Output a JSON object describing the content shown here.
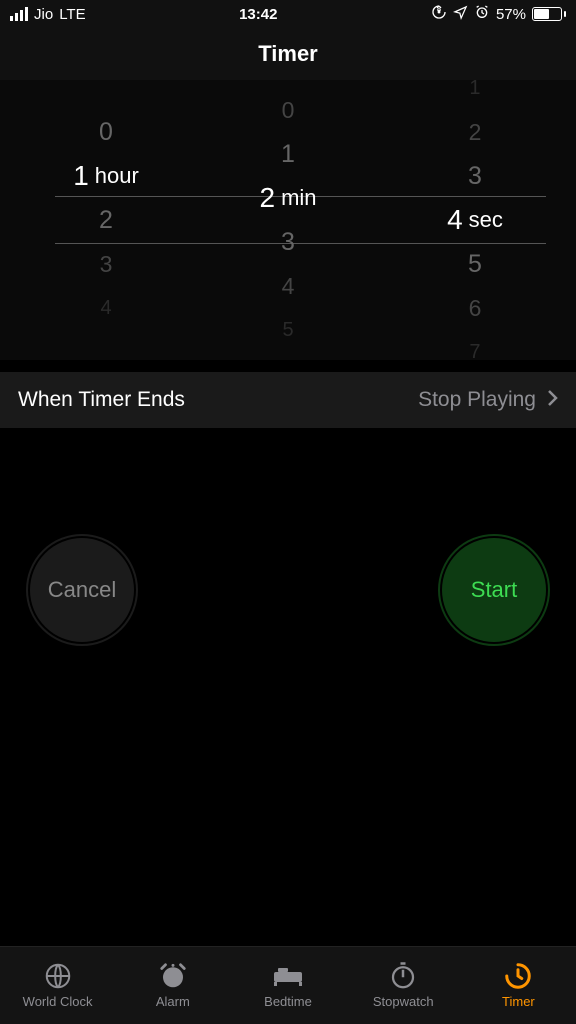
{
  "status": {
    "carrier": "Jio",
    "network": "LTE",
    "time": "13:42",
    "battery_pct": "57%"
  },
  "header": {
    "title": "Timer"
  },
  "picker": {
    "hours": {
      "selected": "1",
      "unit": "hour",
      "above": [
        "0"
      ],
      "below": [
        "2",
        "3",
        "4"
      ]
    },
    "mins": {
      "selected": "2",
      "unit": "min",
      "above": [
        "0",
        "1"
      ],
      "below": [
        "3",
        "4",
        "5"
      ]
    },
    "secs": {
      "selected": "4",
      "unit": "sec",
      "above": [
        "1",
        "2",
        "3"
      ],
      "below": [
        "5",
        "6",
        "7"
      ]
    }
  },
  "row": {
    "label": "When Timer Ends",
    "value": "Stop Playing"
  },
  "buttons": {
    "cancel": "Cancel",
    "start": "Start"
  },
  "tabs": {
    "worldclock": "World Clock",
    "alarm": "Alarm",
    "bedtime": "Bedtime",
    "stopwatch": "Stopwatch",
    "timer": "Timer"
  }
}
